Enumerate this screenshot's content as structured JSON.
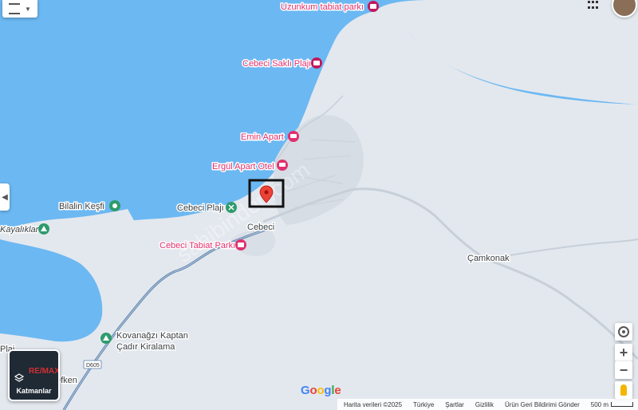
{
  "places": {
    "uzunkum": "Uzunkum tabiat parkı",
    "sakli": "Cebeci Saklı Plajı",
    "emin": "Emin Apart",
    "ergul": "Ergül Apart Otel",
    "bilal": "Bilalin Keşfi",
    "plaj": "Cebeci Plajı",
    "kayalik": "Kayalıklar",
    "cebeci": "Cebeci",
    "tabiat": "Cebeci Tabiat Parkı",
    "camkonak": "Çamkonak",
    "kovan1": "Kovanağzı Kaptan",
    "kovan2": "Çadır Kiralama",
    "plaj_left": "Plaj",
    "kefken": "efken",
    "road": "D605"
  },
  "watermark": "RE/MAX",
  "layers_label": "Katmanlar",
  "google_logo": [
    "G",
    "o",
    "o",
    "g",
    "l",
    "e"
  ],
  "attribution": {
    "data": "Harita verileri ©2025",
    "country": "Türkiye",
    "terms": "Şartlar",
    "privacy": "Gizlilik",
    "feedback": "Ürün Geri Bildirimi Gönder",
    "scale": "500 m"
  },
  "colors": {
    "water": "#64b5f6",
    "land": "#e1e7ed",
    "poi": "#e0306e",
    "pin": "#ea4335"
  }
}
